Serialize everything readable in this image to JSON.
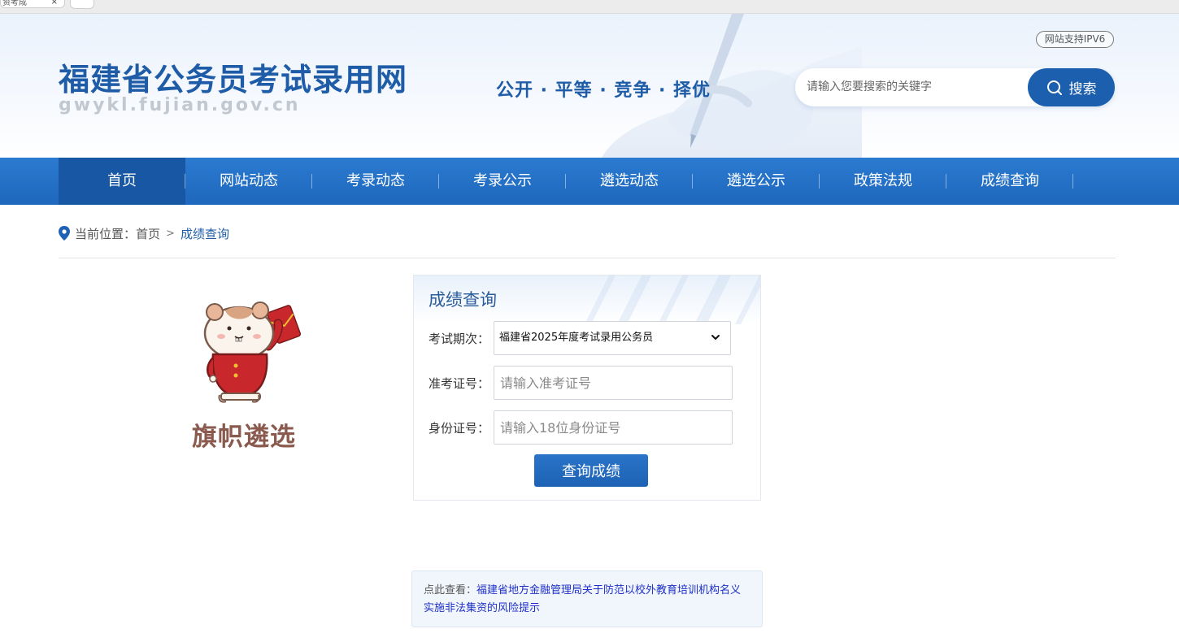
{
  "browser": {
    "tab_title": "资考成",
    "tab_close": "×",
    "nav_button": "〈"
  },
  "header": {
    "site_title": "福建省公务员考试录用网",
    "site_domain": "gwykl.fujian.gov.cn",
    "slogan": "公开 · 平等 · 竞争 · 择优",
    "ipv6_badge": "网站支持IPV6",
    "search": {
      "placeholder": "请输入您要搜索的关键字",
      "button_label": "搜索",
      "icon": "search-icon"
    }
  },
  "nav": {
    "items": [
      {
        "label": "首页",
        "active": true
      },
      {
        "label": "网站动态",
        "active": false
      },
      {
        "label": "考录动态",
        "active": false
      },
      {
        "label": "考录公示",
        "active": false
      },
      {
        "label": "遴选动态",
        "active": false
      },
      {
        "label": "遴选公示",
        "active": false
      },
      {
        "label": "政策法规",
        "active": false
      },
      {
        "label": "成绩查询",
        "active": false
      }
    ]
  },
  "breadcrumb": {
    "prefix": "当前位置：",
    "home": "首页",
    "separator": ">",
    "current": "成绩查询",
    "icon": "location-pin-icon"
  },
  "mascot": {
    "caption": "旗帜遴选"
  },
  "query_panel": {
    "title": "成绩查询",
    "exam_label": "考试期次：",
    "exam_selected": "福建省2025年度考试录用公务员",
    "ticket_label": "准考证号：",
    "ticket_placeholder": "请输入准考证号",
    "id_label": "身份证号：",
    "id_placeholder": "请输入18位身份证号",
    "submit_label": "查询成绩"
  },
  "notice": {
    "prefix": "点此查看：",
    "link_text": "福建省地方金融管理局关于防范以校外教育培训机构名义实施非法集资的风险提示"
  },
  "colors": {
    "brand_blue": "#1f5ca8",
    "nav_blue": "#2372c8",
    "nav_active": "#1757a3",
    "mascot_brown": "#8a5a4e",
    "link_blue": "#1d2fc8"
  }
}
